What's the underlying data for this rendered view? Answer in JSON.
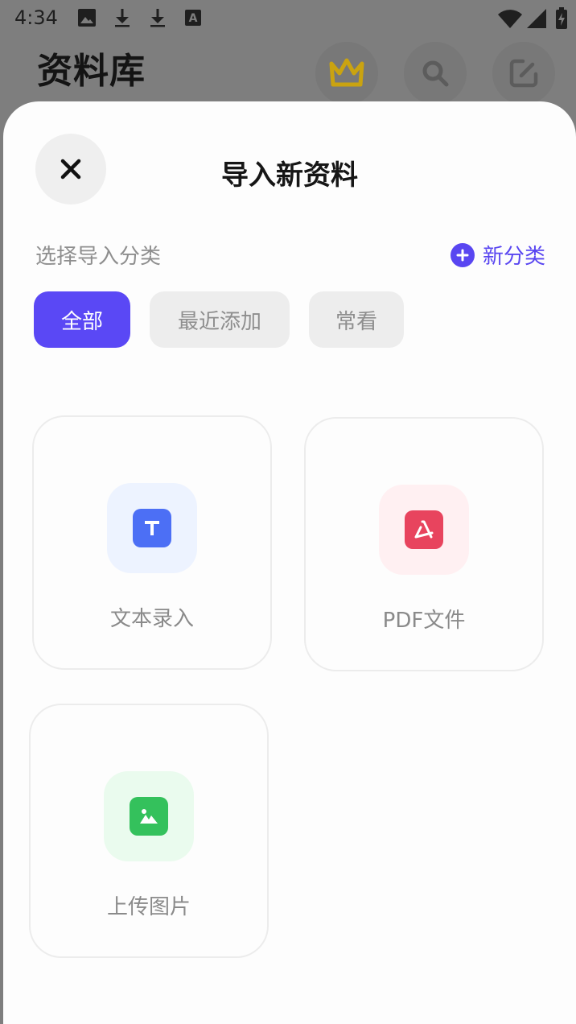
{
  "status_bar": {
    "time": "4:34",
    "icons": [
      "image-icon",
      "download-icon",
      "download-icon",
      "a-box-icon"
    ],
    "right_icons": [
      "wifi-icon",
      "signal-icon",
      "battery-icon"
    ]
  },
  "app_header": {
    "title": "资料库",
    "buttons": [
      "crown-icon",
      "search-icon",
      "edit-icon"
    ],
    "colors": {
      "crown": "#caa310"
    }
  },
  "sheet": {
    "title": "导入新资料",
    "section_label": "选择导入分类",
    "new_category_label": "新分类",
    "categories": [
      {
        "label": "全部",
        "active": true
      },
      {
        "label": "最近添加",
        "active": false
      },
      {
        "label": "常看",
        "active": false
      }
    ],
    "import_options": [
      {
        "label": "文本录入",
        "icon": "text-t-icon",
        "badge_color": "#4c6ff5",
        "tile_color": "#edf3ff"
      },
      {
        "label": "PDF文件",
        "icon": "pdf-icon",
        "badge_color": "#e8445e",
        "tile_color": "#fff0f2"
      },
      {
        "label": "上传图片",
        "icon": "image-icon",
        "badge_color": "#34c15c",
        "tile_color": "#eafbee"
      }
    ],
    "colors": {
      "accent": "#5a48f5"
    }
  }
}
